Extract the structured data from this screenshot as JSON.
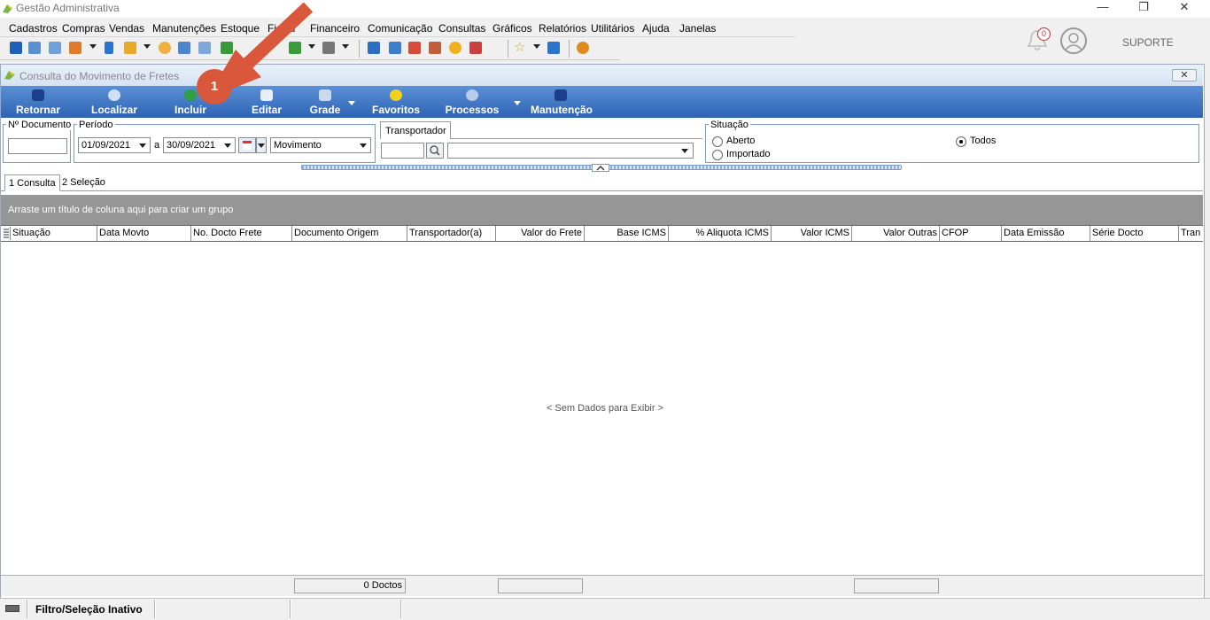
{
  "window": {
    "title": "Gestão Administrativa",
    "controls": [
      "—",
      "❐",
      "✕"
    ]
  },
  "menu": {
    "items": [
      "Cadastros",
      "Compras",
      "Vendas",
      "Manutenções",
      "Estoque",
      "Fiscal",
      "Financeiro",
      "Comunicação",
      "Consultas",
      "Gráficos",
      "Relatórios",
      "Utilitários",
      "Ajuda",
      "Janelas"
    ]
  },
  "user": {
    "notification_count": "0",
    "name": "SUPORTE"
  },
  "form": {
    "title": "Consulta do Movimento de Fretes",
    "close_label": "✕"
  },
  "actions": {
    "retornar": "Retornar",
    "localizar": "Localizar",
    "incluir": "Incluir",
    "editar": "Editar",
    "grade": "Grade",
    "favoritos": "Favoritos",
    "processos": "Processos",
    "manutencao": "Manutenção"
  },
  "filters": {
    "documento_label": "Nº Documento",
    "documento_value": "",
    "periodo_label": "Período",
    "date_from": "01/09/2021",
    "date_sep": "a",
    "date_to": "30/09/2021",
    "date_type": "Movimento",
    "transportador_tab": "Transportador",
    "transportador_code": "",
    "transportador_name": "",
    "situacao_label": "Situação",
    "situacao_options": [
      "Aberto",
      "Importado",
      "Todos"
    ],
    "situacao_selected": "Todos"
  },
  "tabs": [
    "1 Consulta",
    "2 Seleção"
  ],
  "grid": {
    "group_hint": "Arraste um título de coluna aqui para criar um grupo",
    "columns": [
      "Situação",
      "Data Movto",
      "No. Docto Frete",
      "Documento Origem",
      "Transportador(a)",
      "Valor do Frete",
      "Base ICMS",
      "% Aliquota ICMS",
      "Valor ICMS",
      "Valor Outras",
      "CFOP",
      "Data Emissão",
      "Série Docto",
      "Tran"
    ],
    "empty_message": "< Sem Dados para Exibir >",
    "footer_count": "0 Doctos"
  },
  "status": {
    "text": "Filtro/Seleção Inativo"
  },
  "annotation": {
    "badge": "1",
    "color": "#d9573a"
  }
}
